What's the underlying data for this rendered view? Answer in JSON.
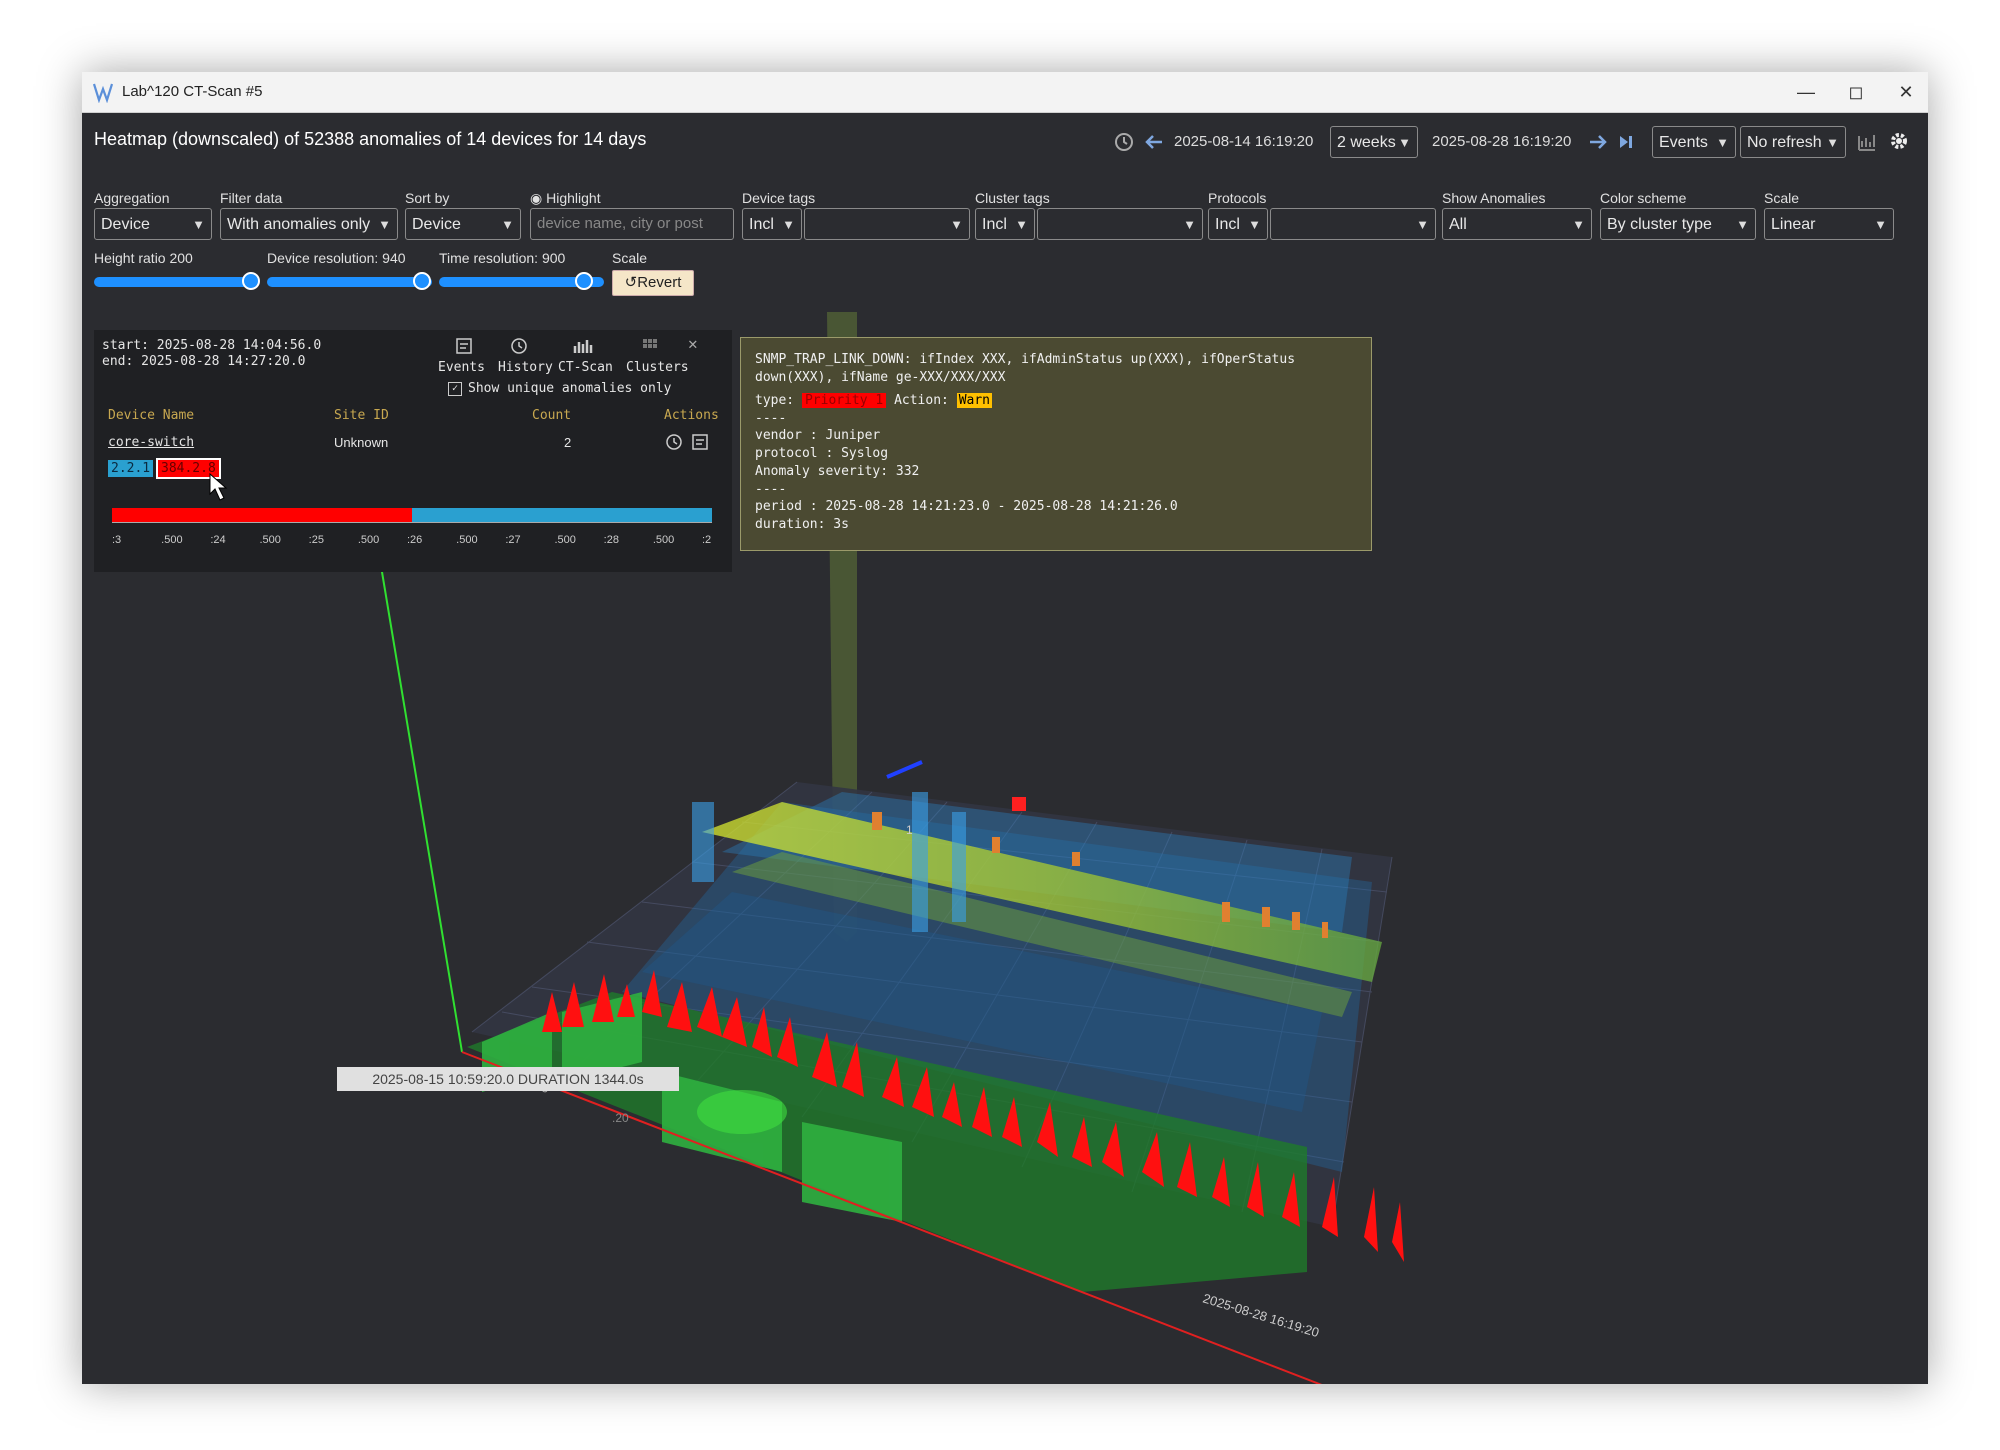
{
  "window": {
    "title": "Lab^120 CT-Scan #5"
  },
  "header": {
    "title": "Heatmap (downscaled) of 52388 anomalies of 14 devices for 14 days",
    "start_time": "2025-08-14 16:19:20",
    "period": "2 weeks",
    "end_time": "2025-08-28 16:19:20",
    "view_mode": "Events",
    "refresh": "No refresh"
  },
  "controls": {
    "aggregation": {
      "label": "Aggregation",
      "value": "Device"
    },
    "filter": {
      "label": "Filter data",
      "value": "With anomalies only"
    },
    "sort": {
      "label": "Sort by",
      "value": "Device"
    },
    "highlight": {
      "label": "Highlight",
      "placeholder": "device name, city or post"
    },
    "device_tags": {
      "label": "Device tags",
      "mode": "Incl",
      "value": ""
    },
    "cluster_tags": {
      "label": "Cluster tags",
      "mode": "Incl",
      "value": ""
    },
    "protocols": {
      "label": "Protocols",
      "mode": "Incl",
      "value": ""
    },
    "show_anomalies": {
      "label": "Show Anomalies",
      "value": "All"
    },
    "color_scheme": {
      "label": "Color scheme",
      "value": "By cluster type"
    },
    "scale": {
      "label": "Scale",
      "value": "Linear"
    },
    "height_ratio": {
      "label": "Height ratio 200",
      "level": 0.95
    },
    "device_resolution": {
      "label": "Device resolution: 940",
      "level": 0.94
    },
    "time_resolution": {
      "label": "Time resolution: 900",
      "level": 0.9
    },
    "scale2": {
      "label": "Scale",
      "button": "Revert"
    }
  },
  "panel": {
    "start": "start: 2025-08-28 14:04:56.0",
    "end": "end: 2025-08-28 14:27:20.0",
    "tabs": [
      "Events",
      "History",
      "CT-Scan",
      "Clusters"
    ],
    "unique_label": "Show unique anomalies only",
    "columns": [
      "Device Name",
      "Site ID",
      "Count",
      "Actions"
    ],
    "row": {
      "device": "core-switch",
      "site": "Unknown",
      "count": "2"
    },
    "tag_a": "2.2.1",
    "tag_b": "384.2.8",
    "axis_ticks": [
      ":3",
      ".500",
      ":24",
      ".500",
      ":25",
      ".500",
      ":26",
      ".500",
      ":27",
      ".500",
      ":28",
      ".500",
      ":2"
    ],
    "timeline_red_fraction": 0.5
  },
  "tooltip": {
    "line1": "SNMP_TRAP_LINK_DOWN: ifIndex XXX, ifAdminStatus up(XXX), ifOperStatus",
    "line2": "down(XXX), ifName ge-XXX/XXX/XXX",
    "type_label": "type:",
    "type_value": "Priority 1",
    "action_label": "Action:",
    "action_value": "Warn",
    "sep": "----",
    "vendor": "vendor : Juniper",
    "protocol": "protocol : Syslog",
    "severity": "Anomaly severity: 332",
    "period": "period : 2025-08-28 14:21:23.0 - 2025-08-28 14:21:26.0",
    "duration": "duration: 3s"
  },
  "scene": {
    "hover_label": "2025-08-15 10:59:20.0 DURATION 1344.0s",
    "axis_end_label": "2025-08-28 16:19:20",
    "axis_start_label": "2025",
    "axis_start_label2": ".20",
    "marker": "1"
  },
  "colors": {
    "accent": "#1e90ff",
    "priority": "#ff0000",
    "warn": "#ffc000",
    "tag_blue": "#2aa0d0"
  }
}
